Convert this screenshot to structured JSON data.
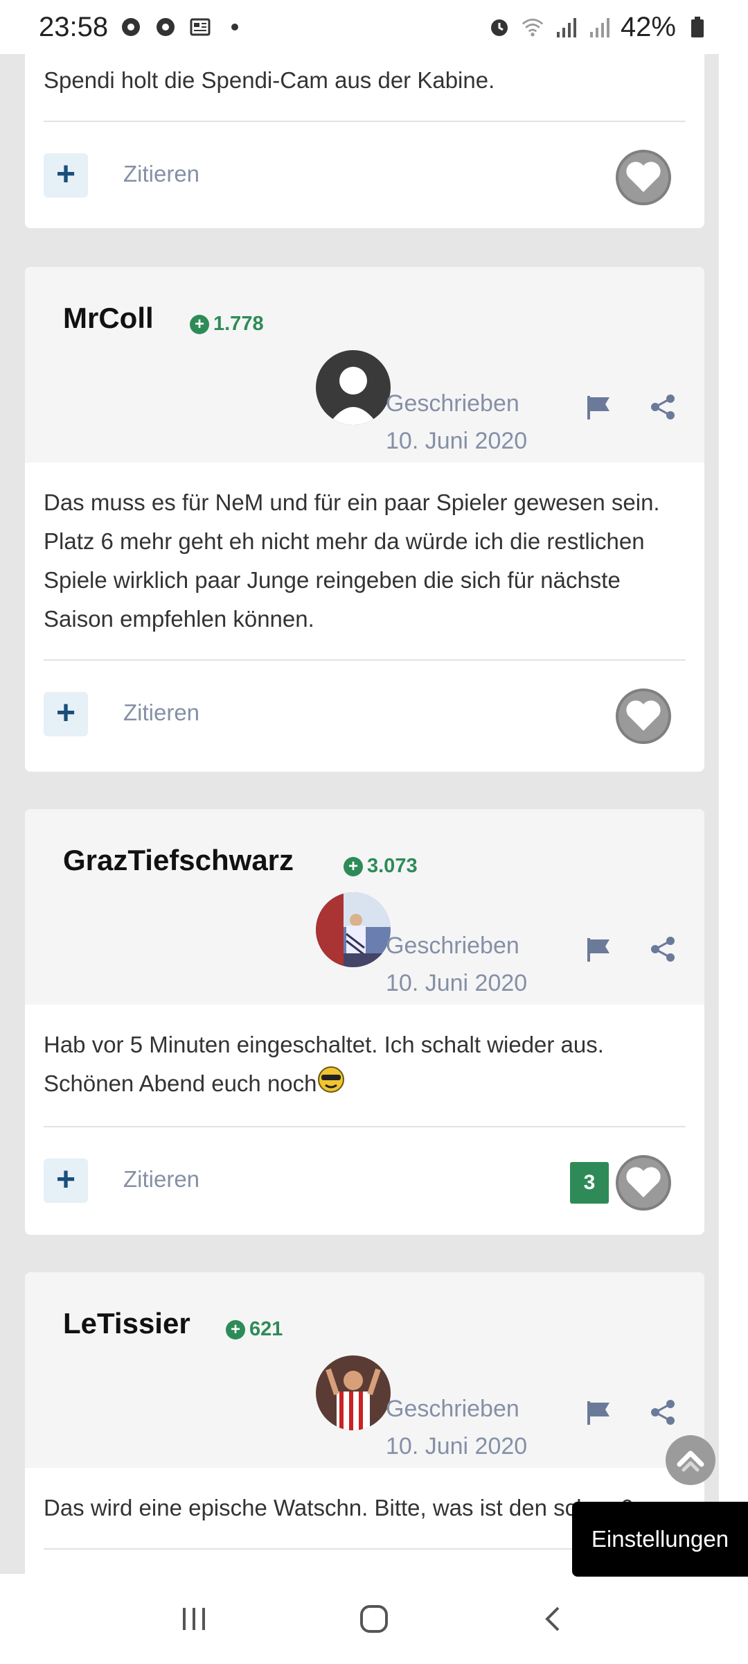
{
  "status_bar": {
    "time": "23:58",
    "battery": "42%",
    "icons": [
      "chrome-icon",
      "chrome-icon",
      "news-icon",
      "dot-icon",
      "alarm-icon",
      "wifi-icon",
      "signal-icon",
      "signal-icon",
      "battery-icon"
    ]
  },
  "posts": [
    {
      "text": "Spendi holt die Spendi-Cam aus der Kabine.",
      "quote_label": "Zitieren"
    },
    {
      "author": "MrColl",
      "reputation": "1.778",
      "written_label": "Geschrieben",
      "date": "10. Juni 2020",
      "text": "Das muss es für NeM und für ein paar Spieler gewesen sein. Platz 6 mehr geht eh nicht mehr da würde ich die restlichen Spiele wirklich paar Junge reingeben die sich für nächste Saison empfehlen können.",
      "quote_label": "Zitieren"
    },
    {
      "author": "GrazTiefschwarz",
      "reputation": "3.073",
      "written_label": "Geschrieben",
      "date": "10. Juni 2020",
      "text": "Hab vor 5 Minuten eingeschaltet. Ich schalt wieder aus. Schönen Abend euch noch",
      "quote_label": "Zitieren",
      "like_count": "3"
    },
    {
      "author": "LeTissier",
      "reputation": "621",
      "written_label": "Geschrieben",
      "date": "10. Juni 2020",
      "text": "Das wird eine epische Watschn. Bitte, was ist den schon 0"
    }
  ],
  "settings_label": "Einstellungen",
  "colors": {
    "reputation": "#2e8b57",
    "meta": "#8590a6",
    "like_badge": "#2e8b57",
    "header_bg": "#f5f5f6",
    "page_bg": "#e6e6e6"
  }
}
